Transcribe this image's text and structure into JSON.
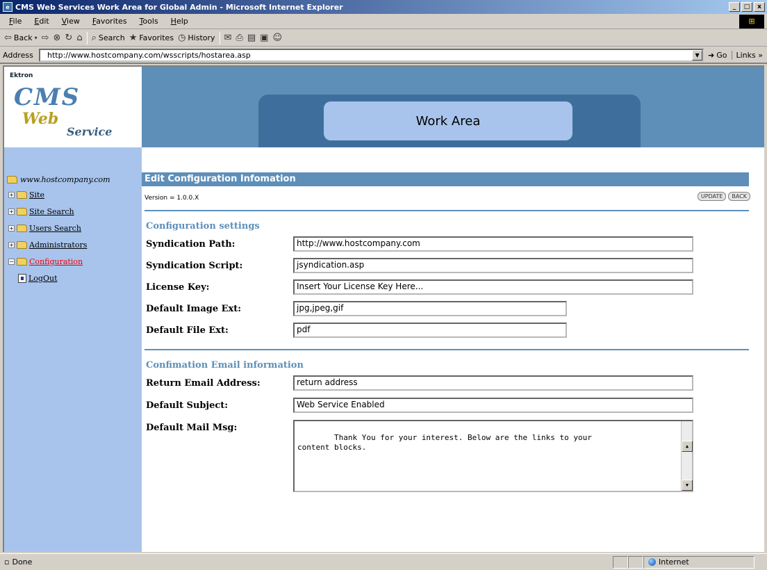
{
  "window": {
    "title": "CMS Web Services Work Area for Global Admin - Microsoft Internet Explorer",
    "controls": {
      "minimize": "_",
      "maximize": "□",
      "close": "x"
    }
  },
  "menu": [
    "File",
    "Edit",
    "View",
    "Favorites",
    "Tools",
    "Help"
  ],
  "toolbar": {
    "back": "Back",
    "search": "Search",
    "favorites": "Favorites",
    "history": "History"
  },
  "address": {
    "label": "Address",
    "url": "http://www.hostcompany.com/wsscripts/hostarea.asp",
    "go": "Go",
    "links": "Links"
  },
  "banner": {
    "logo_top": "Ektron",
    "logo_cms": "CMS",
    "logo_web": "Web",
    "logo_service": "Service",
    "work_area": "Work Area"
  },
  "sidebar": {
    "root": "www.hostcompany.com",
    "items": [
      {
        "label": "Site"
      },
      {
        "label": "Site Search"
      },
      {
        "label": "Users Search"
      },
      {
        "label": "Administrators"
      },
      {
        "label": "Configuration"
      },
      {
        "label": "LogOut"
      }
    ]
  },
  "main": {
    "header": "Edit Configuration Infomation",
    "version": "Version = 1.0.0.X",
    "update": "UPDATE",
    "back": "BACK",
    "config_section": "Configuration settings",
    "email_section": "Confimation Email information",
    "fields": {
      "syndication_path": {
        "label": "Syndication Path:",
        "value": "http://www.hostcompany.com"
      },
      "syndication_script": {
        "label": "Syndication Script:",
        "value": "jsyndication.asp"
      },
      "license_key": {
        "label": "License Key:",
        "value": "Insert Your License Key Here..."
      },
      "default_image_ext": {
        "label": "Default Image Ext:",
        "value": "jpg,jpeg,gif"
      },
      "default_file_ext": {
        "label": "Default File Ext:",
        "value": "pdf"
      },
      "return_email": {
        "label": "Return Email Address:",
        "value": "return address"
      },
      "default_subject": {
        "label": "Default Subject:",
        "value": "Web Service Enabled"
      },
      "default_mail_msg": {
        "label": "Default Mail Msg:",
        "value": "Thank You for your interest. Below are the links to your\ncontent blocks."
      }
    }
  },
  "status": {
    "text": "Done",
    "zone": "Internet"
  }
}
